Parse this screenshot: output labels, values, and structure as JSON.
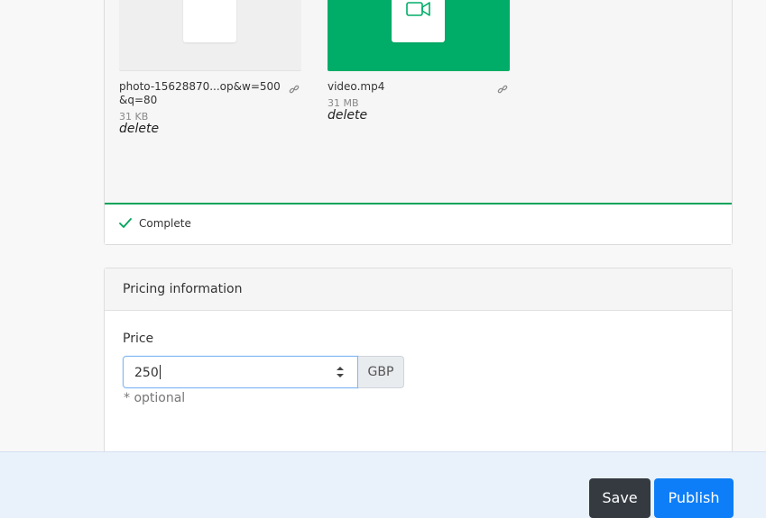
{
  "uploads": {
    "files": [
      {
        "name": "photo-15628870...op&w=500&q=80",
        "size": "31 KB",
        "delete_label": "delete",
        "type": "image"
      },
      {
        "name": "video.mp4",
        "size": "31 MB",
        "delete_label": "delete",
        "type": "video"
      }
    ],
    "status": "Complete",
    "colors": {
      "video_tile": "#00ad68",
      "progress_complete": "#00a35a"
    }
  },
  "pricing": {
    "header": "Pricing information",
    "price_label": "Price",
    "price_value": "250",
    "currency": "GBP",
    "hint": "* optional"
  },
  "actions": {
    "save_label": "Save",
    "publish_label": "Publish",
    "colors": {
      "save": "#343a40",
      "publish": "#0d7ef7"
    }
  }
}
